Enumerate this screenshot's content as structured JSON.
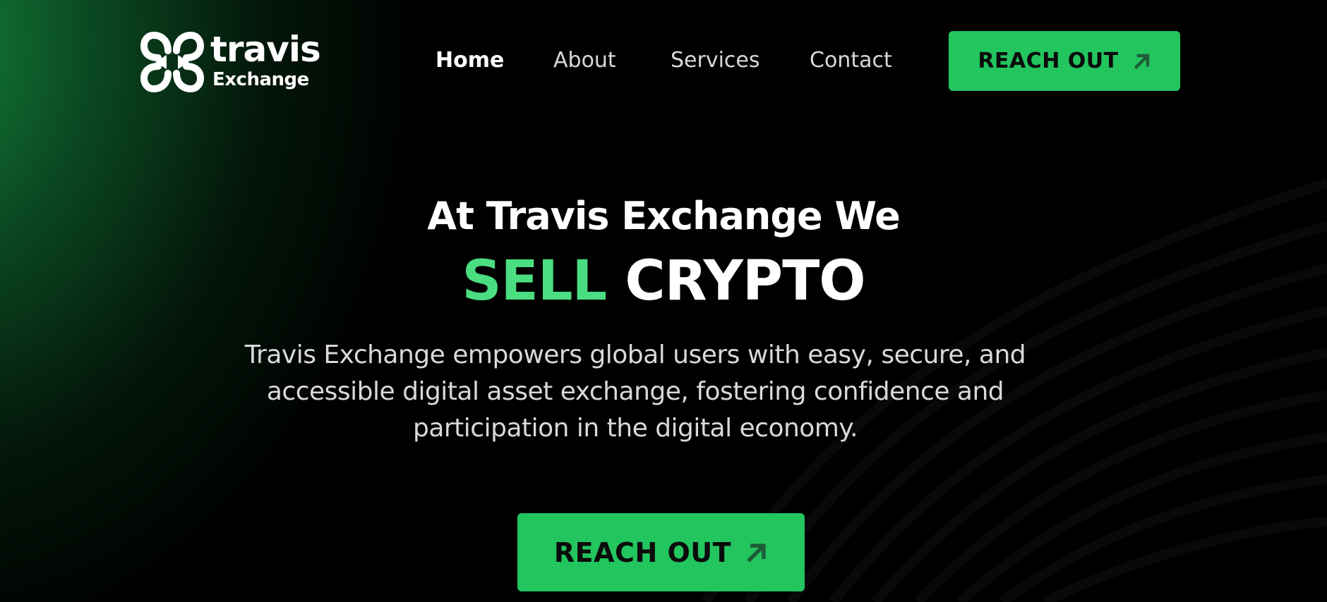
{
  "brand": {
    "name_line1": "travis",
    "name_line2": "Exchange",
    "logo_icon": "clover-arrows-logo-icon",
    "color": "#ffffff"
  },
  "nav": {
    "items": [
      {
        "label": "Home",
        "active": true
      },
      {
        "label": "About",
        "active": false
      },
      {
        "label": "Services",
        "active": false
      },
      {
        "label": "Contact",
        "active": false
      }
    ],
    "cta_label": "REACH OUT",
    "cta_icon": "arrow-up-right-icon"
  },
  "hero": {
    "subtitle": "At Travis Exchange We",
    "title_accent": "SELL",
    "title_rest": "CRYPTO",
    "description": "Travis Exchange empowers global users with easy, secure, and accessible digital asset exchange, fostering confidence and participation in the digital economy.",
    "cta_label": "REACH OUT",
    "cta_icon": "arrow-up-right-icon"
  },
  "colors": {
    "accent": "#22c55e",
    "accent_text": "#4ade80",
    "background": "#000000",
    "gradient_green": "#168c40"
  }
}
